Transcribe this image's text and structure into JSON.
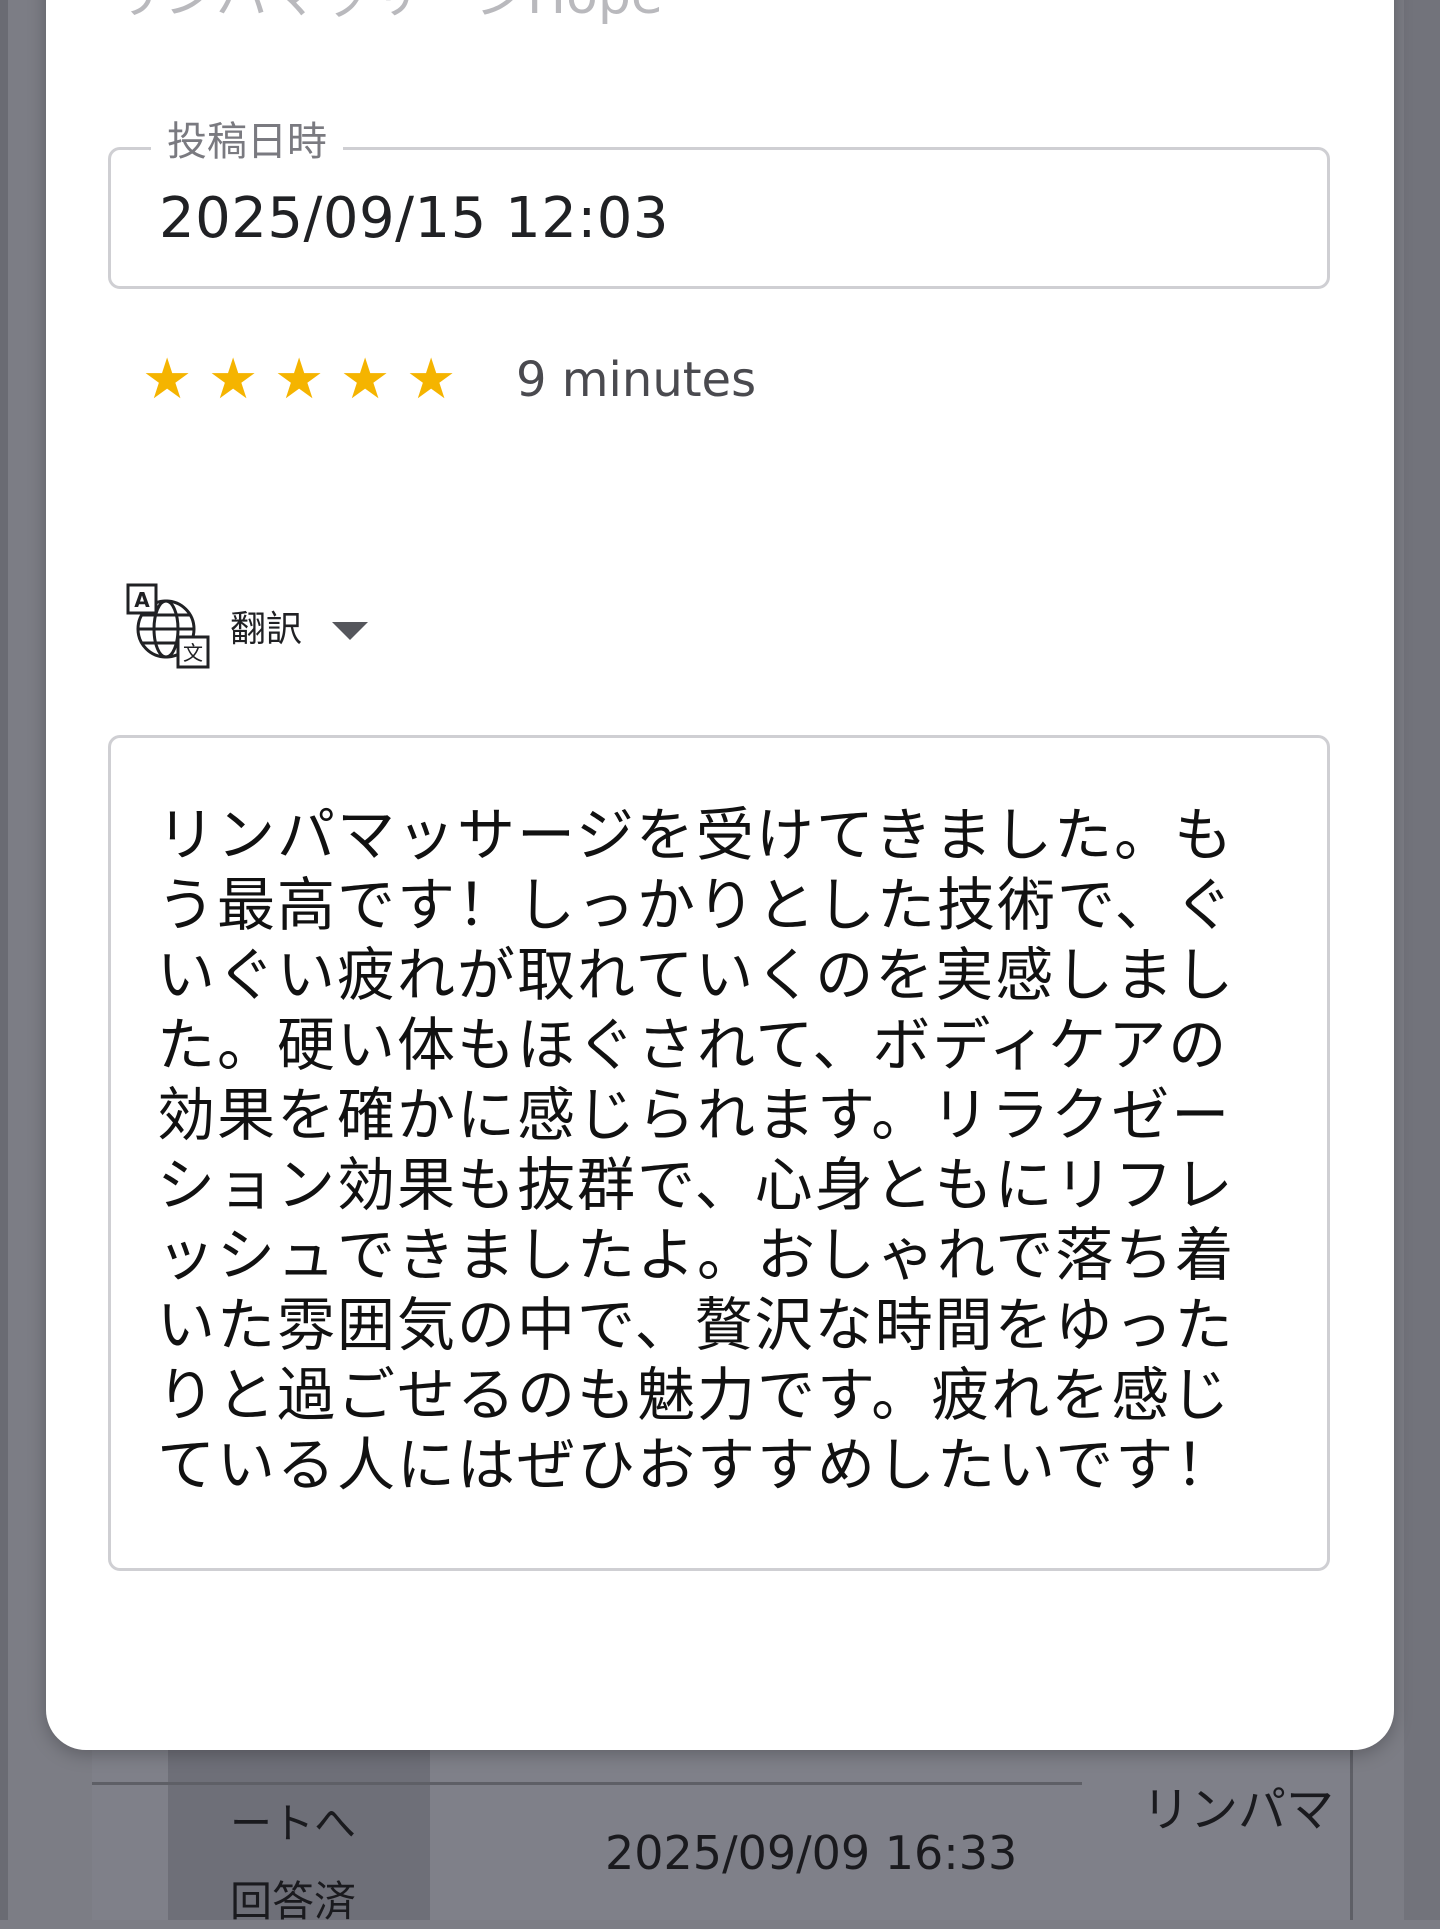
{
  "modal": {
    "shop_name": "リンパマッサージHope",
    "posted_at_label": "投稿日時",
    "posted_at_value": "2025/09/15 12:03",
    "rating": {
      "stars": 5,
      "max_stars": 5,
      "duration": "9 minutes"
    },
    "translate": {
      "label": "翻訳",
      "icon": "translate-icon"
    },
    "review_text": "リンパマッサージを受けてきました。もう最高です！しっかりとした技術で、ぐいぐい疲れが取れていくのを実感しました。硬い体もほぐされて、ボディケアの効果を確かに感じられます。リラクゼーション効果も抜群で、心身ともにリフレッシュできましたよ。おしゃれで落ち着いた雰囲気の中で、贅沢な時間をゆったりと過ごせるのも魅力です。疲れを感じている人にはぜひおすすめしたいです！"
  },
  "background_table": {
    "row": {
      "status_line_1": "ートへ",
      "status_line_2": "回答済",
      "date": "2025/09/09 16:33",
      "name": "リンパマ"
    }
  },
  "colors": {
    "star": "#f5b400",
    "overlay": "#7c7d85",
    "border": "#cfcfd3"
  }
}
